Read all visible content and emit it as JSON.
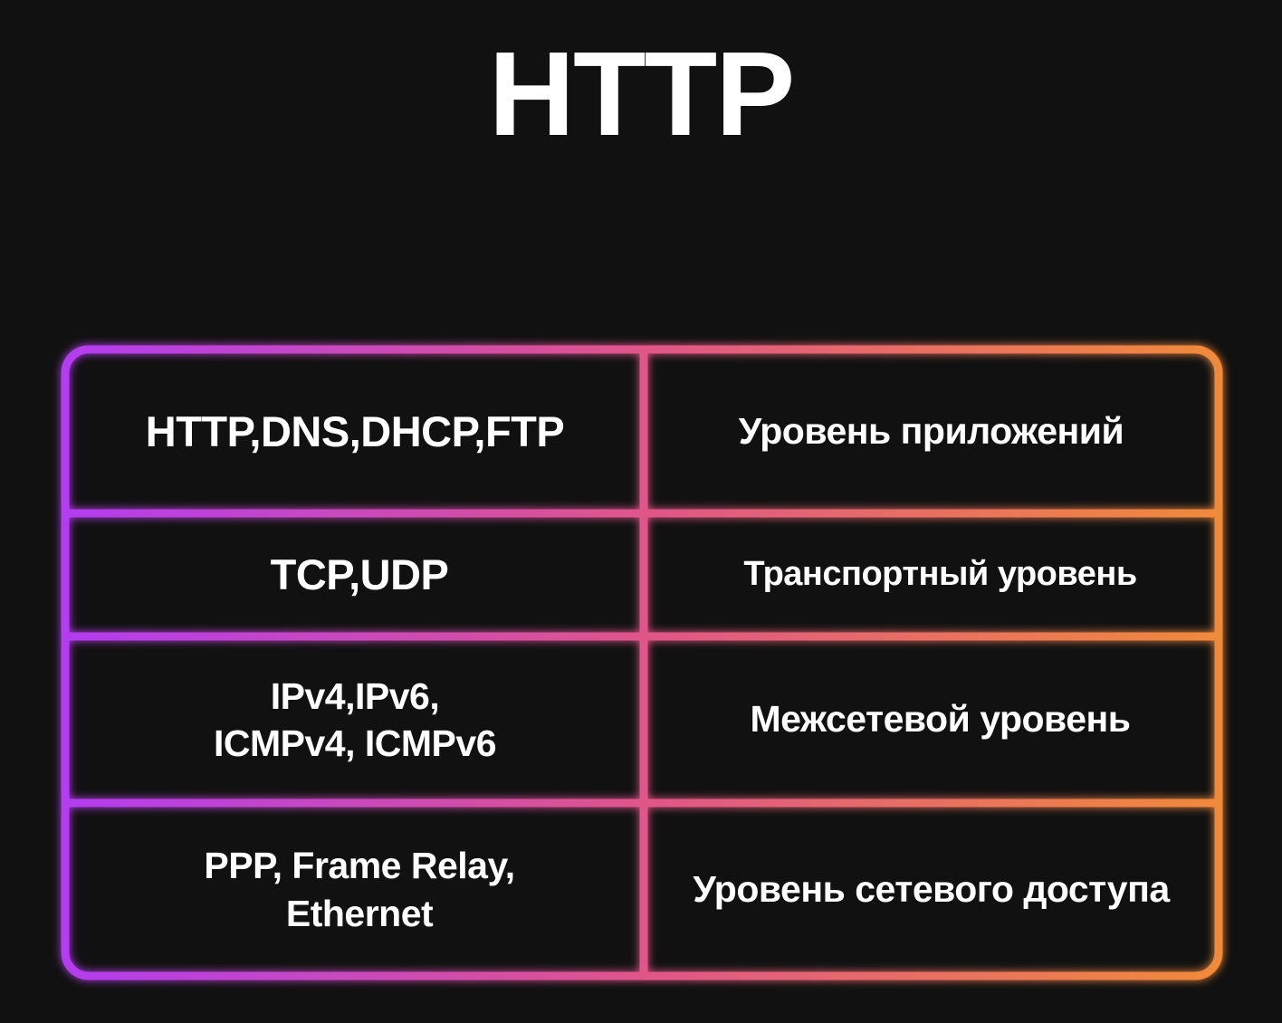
{
  "title": "HTTP",
  "table": {
    "rows": [
      {
        "protocols": "HTTP,DNS,DHCP,FTP",
        "layer": "Уровень приложений"
      },
      {
        "protocols": "TCP,UDP",
        "layer": "Транспортный уровень"
      },
      {
        "protocols": "IPv4,IPv6,\nICMPv4, ICMPv6",
        "layer": "Межсетевой уровень"
      },
      {
        "protocols": "PPP, Frame Relay,\nEthernet",
        "layer": "Уровень сетевого доступа"
      }
    ]
  },
  "colors": {
    "background": "#111111",
    "gradient_start": "#b33cf0",
    "gradient_mid": "#e0558a",
    "gradient_end": "#f08a3a",
    "text": "#ffffff"
  }
}
